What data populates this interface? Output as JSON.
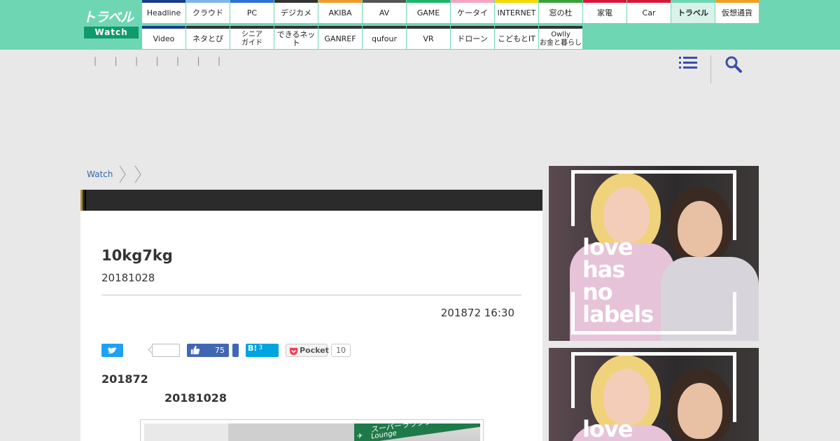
{
  "header": {
    "logo_top": "トラベル",
    "logo_bottom": "Watch",
    "nav_row1": [
      {
        "label": "Headline",
        "color": "#1a3a8a"
      },
      {
        "label": "クラウド",
        "color": "#7fb6e8"
      },
      {
        "label": "PC",
        "color": "#2d6fd4"
      },
      {
        "label": "デジカメ",
        "color": "#333333"
      },
      {
        "label": "AKIBA",
        "color": "#f09a2a"
      },
      {
        "label": "AV",
        "color": "#555555"
      },
      {
        "label": "GAME",
        "color": "#1fb36b"
      },
      {
        "label": "ケータイ",
        "color": "#f4a6c0"
      },
      {
        "label": "INTERNET",
        "color": "#f5d800"
      },
      {
        "label": "窓の杜",
        "color": "#3aa03a"
      },
      {
        "label": "家電",
        "color": "#d9163a"
      },
      {
        "label": "Car",
        "color": "#d9163a"
      },
      {
        "label": "トラベル",
        "color": "#6fd6b3"
      },
      {
        "label": "仮想通貨",
        "color": "#f0a020"
      }
    ],
    "nav_row2": [
      {
        "label": "Video",
        "color": "#1a3a8a"
      },
      {
        "label": "ネタとぴ",
        "color": "#333333"
      },
      {
        "label": "シニア\nガイド",
        "color": "#333333"
      },
      {
        "label": "できるネット",
        "color": "#333333"
      },
      {
        "label": "GANREF",
        "color": "#333333"
      },
      {
        "label": "qufour",
        "color": "#333333"
      },
      {
        "label": "VR",
        "color": "#333333"
      },
      {
        "label": "ドローン",
        "color": "#333333"
      },
      {
        "label": "こどもとIT",
        "color": "#333333"
      },
      {
        "label": "Owlly\nお金と暮らし",
        "color": "#333333"
      }
    ],
    "active_label": "トラベル"
  },
  "subbar": {
    "dividers": [
      "|",
      "|",
      "|",
      "|",
      "|",
      "|",
      "|"
    ]
  },
  "breadcrumb": {
    "items": [
      "Watch"
    ]
  },
  "article": {
    "title": "10kg7kg",
    "subtitle": "20181028",
    "date": "201872 16:30",
    "share": {
      "facebook_count": "75",
      "hatena_label": "B!",
      "hatena_count": "3",
      "pocket_label": "Pocket",
      "pocket_count": "10"
    },
    "body_date1": "201872",
    "body_date2": "20181028",
    "photo_sign_text": "スーパーラウンジ",
    "photo_sign_text2": "Lounge"
  },
  "ads": {
    "text_lines": [
      "love",
      "has",
      "no",
      "labels"
    ],
    "ad2_text_lines": [
      "love"
    ]
  },
  "colors": {
    "header_bg": "#6fd6b3",
    "logo_dark": "#0f9a6e",
    "link": "#3366aa"
  }
}
